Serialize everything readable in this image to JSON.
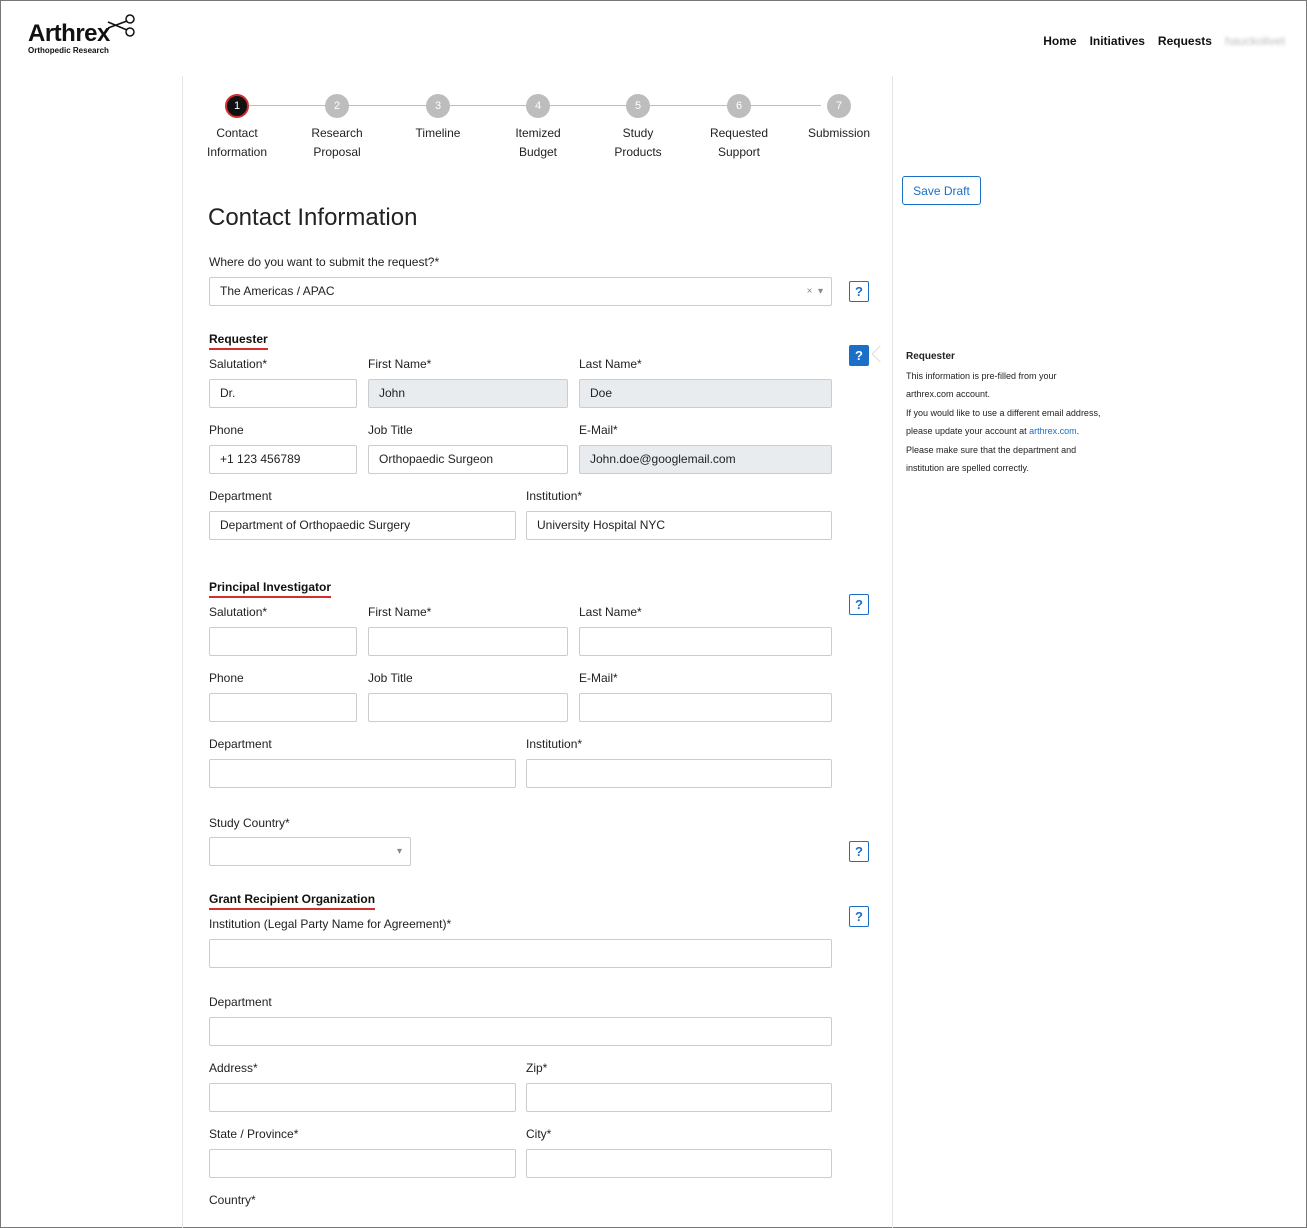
{
  "header": {
    "logo_word": "Arthrex",
    "logo_sub": "Orthopedic Research",
    "nav": [
      "Home",
      "Initiatives",
      "Requests"
    ],
    "user": "hauckolivet"
  },
  "steps": [
    {
      "num": "1",
      "label": "Contact Information"
    },
    {
      "num": "2",
      "label": "Research Proposal"
    },
    {
      "num": "3",
      "label": "Timeline"
    },
    {
      "num": "4",
      "label": "Itemized Budget"
    },
    {
      "num": "5",
      "label": "Study Products"
    },
    {
      "num": "6",
      "label": "Requested Support"
    },
    {
      "num": "7",
      "label": "Submission"
    }
  ],
  "page_title": "Contact Information",
  "save_draft": "Save Draft",
  "submit_region": {
    "label": "Where do you want to submit the request?*",
    "value": "The Americas / APAC",
    "clear": "×",
    "caret": "▾"
  },
  "help_glyph": "?",
  "requester": {
    "heading": "Requester",
    "salutation_label": "Salutation*",
    "salutation": "Dr.",
    "first_label": "First Name*",
    "first": "John",
    "last_label": "Last Name*",
    "last": "Doe",
    "phone_label": "Phone",
    "phone": "+1 123 456789",
    "job_label": "Job Title",
    "job": "Orthopaedic Surgeon",
    "email_label": "E-Mail*",
    "email": "John.doe@googlemail.com",
    "dept_label": "Department",
    "dept": "Department of Orthopaedic Surgery",
    "inst_label": "Institution*",
    "inst": "University Hospital NYC"
  },
  "pi": {
    "heading": "Principal Investigator",
    "salutation_label": "Salutation*",
    "first_label": "First Name*",
    "last_label": "Last Name*",
    "phone_label": "Phone",
    "job_label": "Job Title",
    "email_label": "E-Mail*",
    "dept_label": "Department",
    "inst_label": "Institution*",
    "country_label": "Study Country*",
    "caret": "▾"
  },
  "grant": {
    "heading": "Grant Recipient Organization",
    "inst_label": "Institution (Legal Party Name for Agreement)*",
    "dept_label": "Department",
    "address_label": "Address*",
    "zip_label": "Zip*",
    "state_label": "State / Province*",
    "city_label": "City*",
    "country_label": "Country*"
  },
  "tooltip": {
    "title": "Requester",
    "line1": "This information is pre-filled from your",
    "line2": "arthrex.com account.",
    "line3": "If you would like to use a different email address,",
    "line4_pre": "please update your account at ",
    "line4_link": "arthrex.com",
    "line4_post": ".",
    "line5": "Please make sure that the department and",
    "line6": "institution are spelled correctly."
  },
  "colors": {
    "accent": "#1a6fc9",
    "brand_red": "#d32f2f",
    "disabled_bg": "#e9ecef"
  }
}
